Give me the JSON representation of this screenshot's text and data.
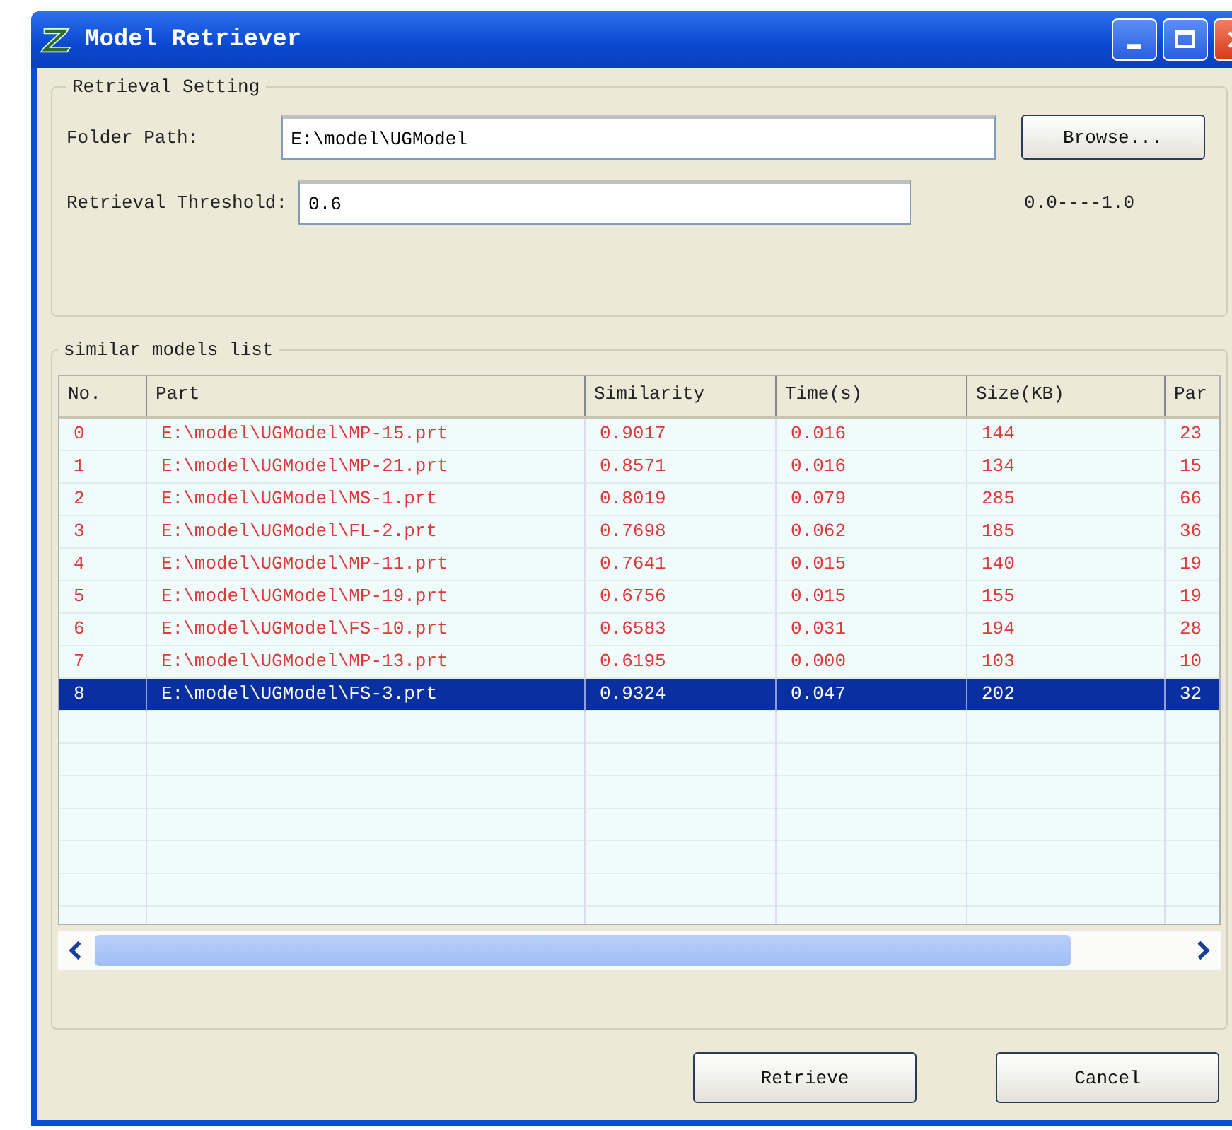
{
  "window": {
    "title": "Model Retriever"
  },
  "retrieval_setting": {
    "title": "Retrieval Setting",
    "folder_path": {
      "label": "Folder Path:",
      "value": "E:\\model\\UGModel"
    },
    "browse_button": "Browse...",
    "threshold": {
      "label": "Retrieval Threshold:",
      "value": "0.6"
    },
    "range_hint": "0.0----1.0"
  },
  "similar_models": {
    "title": "similar models list",
    "columns": [
      "No.",
      "Part",
      "Similarity",
      "Time(s)",
      "Size(KB)",
      "Par"
    ],
    "rows": [
      {
        "cells": [
          "0",
          "E:\\model\\UGModel\\MP-15.prt",
          "0.9017",
          "0.016",
          "144",
          "23"
        ],
        "selected": false
      },
      {
        "cells": [
          "1",
          "E:\\model\\UGModel\\MP-21.prt",
          "0.8571",
          "0.016",
          "134",
          "15"
        ],
        "selected": false
      },
      {
        "cells": [
          "2",
          "E:\\model\\UGModel\\MS-1.prt",
          "0.8019",
          "0.079",
          "285",
          "66"
        ],
        "selected": false
      },
      {
        "cells": [
          "3",
          "E:\\model\\UGModel\\FL-2.prt",
          "0.7698",
          "0.062",
          "185",
          "36"
        ],
        "selected": false
      },
      {
        "cells": [
          "4",
          "E:\\model\\UGModel\\MP-11.prt",
          "0.7641",
          "0.015",
          "140",
          "19"
        ],
        "selected": false
      },
      {
        "cells": [
          "5",
          "E:\\model\\UGModel\\MP-19.prt",
          "0.6756",
          "0.015",
          "155",
          "19"
        ],
        "selected": false
      },
      {
        "cells": [
          "6",
          "E:\\model\\UGModel\\FS-10.prt",
          "0.6583",
          "0.031",
          "194",
          "28"
        ],
        "selected": false
      },
      {
        "cells": [
          "7",
          "E:\\model\\UGModel\\MP-13.prt",
          "0.6195",
          "0.000",
          "103",
          "10"
        ],
        "selected": false
      },
      {
        "cells": [
          "8",
          "E:\\model\\UGModel\\FS-3.prt",
          "0.9324",
          "0.047",
          "202",
          "32"
        ],
        "selected": true
      }
    ]
  },
  "buttons": [
    "Retrieve",
    "Cancel"
  ]
}
